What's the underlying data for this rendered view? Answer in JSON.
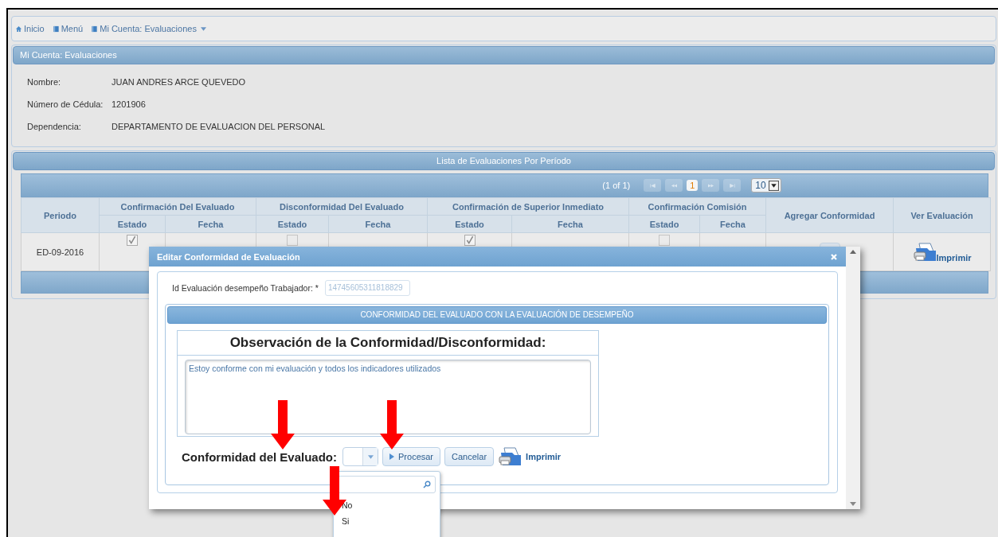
{
  "breadcrumb": [
    {
      "label": "Inicio"
    },
    {
      "label": "Menú"
    },
    {
      "label": "Mi Cuenta: Evaluaciones"
    }
  ],
  "panel": {
    "title": "Mi Cuenta: Evaluaciones",
    "fields": [
      {
        "label": "Nombre:",
        "value": "JUAN ANDRES ARCE QUEVEDO"
      },
      {
        "label": "Número de Cédula:",
        "value": "1201906"
      },
      {
        "label": "Dependencia:",
        "value": "DEPARTAMENTO DE EVALUACION DEL PERSONAL"
      }
    ]
  },
  "list": {
    "title": "Lista de Evaluaciones Por Período",
    "paginator": {
      "status": "(1 of 1)",
      "pages": [
        {
          "label": "1",
          "selected": true
        }
      ],
      "rows_per_page": "10"
    },
    "groups": [
      {
        "label": "Confirmación Del Evaluado",
        "columns": [
          "Estado",
          "Fecha"
        ]
      },
      {
        "label": "Disconformidad Del Evaluado",
        "columns": [
          "Estado",
          "Fecha"
        ]
      },
      {
        "label": "Confirmación de Superior Inmediato",
        "columns": [
          "Estado",
          "Fecha"
        ]
      },
      {
        "label": "Confirmación Comisión",
        "columns": [
          "Estado",
          "Fecha"
        ]
      }
    ],
    "periodo_header": "Periodo",
    "agregar_header": "Agregar Conformidad",
    "ver_header": "Ver Evaluación",
    "rows": [
      {
        "periodo": "ED-09-2016",
        "estados": [
          {
            "checked": true
          },
          {
            "checked": false
          },
          {
            "checked": true
          },
          {
            "checked": false
          }
        ],
        "print": "Imprimir"
      }
    ]
  },
  "dialog": {
    "title": "Editar Conformidad de Evaluación",
    "id_label": "Id Evaluación desempeño Trabajador: *",
    "id_value": "14745605311818829",
    "section_title": "CONFORMIDAD DEL EVALUADO CON LA EVALUACIÓN DE DESEMPEÑO",
    "observation_title": "Observación de la Conformidad/Disconformidad:",
    "observation": "Estoy conforme con mi evaluación y todos los indicadores utilizados",
    "conformity_label": "Conformidad del Evaluado:",
    "buttons": [
      {
        "label": "Procesar",
        "kind": "primary"
      },
      {
        "label": "Cancelar",
        "kind": "plain"
      }
    ],
    "print": "Imprimir"
  },
  "dropdown": {
    "options": [
      {
        "label": "No"
      },
      {
        "label": "Si"
      }
    ]
  }
}
